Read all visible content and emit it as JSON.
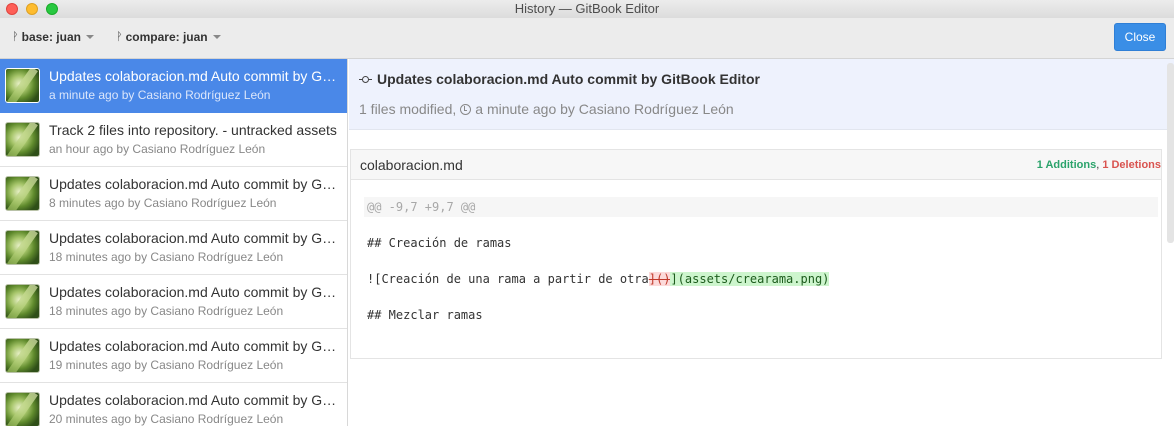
{
  "window": {
    "title": "History — GitBook Editor"
  },
  "toolbar": {
    "base_label": "base: juan",
    "compare_label": "compare: juan",
    "close_label": "Close"
  },
  "commits": [
    {
      "title": "Updates colaboracion.md Auto commit by GitBook Editor",
      "meta": "a minute ago by Casiano Rodríguez León",
      "active": true
    },
    {
      "title": "Track 2 files into repository. - untracked assets",
      "meta": "an hour ago by Casiano Rodríguez León"
    },
    {
      "title": "Updates colaboracion.md Auto commit by GitBook Editor",
      "meta": "8 minutes ago by Casiano Rodríguez León"
    },
    {
      "title": "Updates colaboracion.md Auto commit by GitBook Editor",
      "meta": "18 minutes ago by Casiano Rodríguez León"
    },
    {
      "title": "Updates colaboracion.md Auto commit by GitBook Editor",
      "meta": "18 minutes ago by Casiano Rodríguez León"
    },
    {
      "title": "Updates colaboracion.md Auto commit by GitBook Editor",
      "meta": "19 minutes ago by Casiano Rodríguez León"
    },
    {
      "title": "Updates colaboracion.md Auto commit by GitBook Editor",
      "meta": "20 minutes ago by Casiano Rodríguez León"
    }
  ],
  "detail": {
    "title": "Updates colaboracion.md Auto commit by GitBook Editor",
    "files_modified": "1 files modified,",
    "time_author": "a minute ago by Casiano Rodríguez León"
  },
  "diff": {
    "file_name": "colaboracion.md",
    "additions": "1 Additions",
    "separator": ", ",
    "deletions": "1 Deletions",
    "hunk_header": "@@ -9,7 +9,7 @@",
    "line1": "## Creación de ramas",
    "line2_prefix": "![Creación de una rama a partir de otra",
    "line2_removed": "]()",
    "line2_added": "](assets/crearama.png)",
    "line3": "## Mezclar ramas"
  },
  "colors": {
    "accent": "#3a8ee6",
    "active_row": "#4a88e8",
    "header_bg": "#eef2fd",
    "additions": "#2ba36b",
    "deletions": "#d9534f"
  }
}
